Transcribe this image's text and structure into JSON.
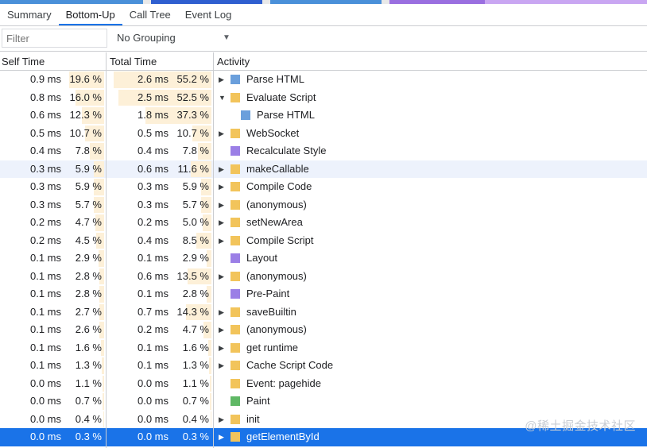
{
  "top_strip_colors": [
    "#4a90d9",
    "#e9e9e9",
    "#2f5fd0",
    "#e9e9e9",
    "#4a90d9",
    "#e9e9e9",
    "#9a6fe0",
    "#c9a6f2"
  ],
  "tabs": [
    {
      "label": "Summary",
      "active": false
    },
    {
      "label": "Bottom-Up",
      "active": true
    },
    {
      "label": "Call Tree",
      "active": false
    },
    {
      "label": "Event Log",
      "active": false
    }
  ],
  "toolbar": {
    "filter_placeholder": "Filter",
    "filter_value": "",
    "grouping_label": "No Grouping",
    "grouping_arrow": "▼"
  },
  "columns": {
    "self_time": "Self Time",
    "total_time": "Total Time",
    "activity": "Activity"
  },
  "colors": {
    "scripting": "#f2c45b",
    "loading": "#6a9fdc",
    "rendering": "#9b7fe6",
    "painting": "#5fb865",
    "bar": "#fdf0d8",
    "selected": "#1a73e8",
    "hover": "#edf2fc"
  },
  "rows": [
    {
      "self_ms": "0.9 ms",
      "self_pct": "19.6 %",
      "self_frac": 0.196,
      "total_ms": "2.6 ms",
      "total_pct": "55.2 %",
      "total_frac": 0.552,
      "expander": "right",
      "indent": 0,
      "category": "loading",
      "name": "Parse HTML",
      "state": ""
    },
    {
      "self_ms": "0.8 ms",
      "self_pct": "16.0 %",
      "self_frac": 0.16,
      "total_ms": "2.5 ms",
      "total_pct": "52.5 %",
      "total_frac": 0.525,
      "expander": "down",
      "indent": 0,
      "category": "scripting",
      "name": "Evaluate Script",
      "state": ""
    },
    {
      "self_ms": "0.6 ms",
      "self_pct": "12.3 %",
      "self_frac": 0.123,
      "total_ms": "1.8 ms",
      "total_pct": "37.3 %",
      "total_frac": 0.373,
      "expander": "none",
      "indent": 1,
      "category": "loading",
      "name": "Parse HTML",
      "state": ""
    },
    {
      "self_ms": "0.5 ms",
      "self_pct": "10.7 %",
      "self_frac": 0.107,
      "total_ms": "0.5 ms",
      "total_pct": "10.7 %",
      "total_frac": 0.107,
      "expander": "right",
      "indent": 0,
      "category": "scripting",
      "name": "WebSocket",
      "state": ""
    },
    {
      "self_ms": "0.4 ms",
      "self_pct": "7.8 %",
      "self_frac": 0.078,
      "total_ms": "0.4 ms",
      "total_pct": "7.8 %",
      "total_frac": 0.078,
      "expander": "none",
      "indent": 0,
      "category": "rendering",
      "name": "Recalculate Style",
      "state": ""
    },
    {
      "self_ms": "0.3 ms",
      "self_pct": "5.9 %",
      "self_frac": 0.059,
      "total_ms": "0.6 ms",
      "total_pct": "11.6 %",
      "total_frac": 0.116,
      "expander": "right",
      "indent": 0,
      "category": "scripting",
      "name": "makeCallable",
      "state": "hover"
    },
    {
      "self_ms": "0.3 ms",
      "self_pct": "5.9 %",
      "self_frac": 0.059,
      "total_ms": "0.3 ms",
      "total_pct": "5.9 %",
      "total_frac": 0.059,
      "expander": "right",
      "indent": 0,
      "category": "scripting",
      "name": "Compile Code",
      "state": ""
    },
    {
      "self_ms": "0.3 ms",
      "self_pct": "5.7 %",
      "self_frac": 0.057,
      "total_ms": "0.3 ms",
      "total_pct": "5.7 %",
      "total_frac": 0.057,
      "expander": "right",
      "indent": 0,
      "category": "scripting",
      "name": "(anonymous)",
      "state": ""
    },
    {
      "self_ms": "0.2 ms",
      "self_pct": "4.7 %",
      "self_frac": 0.047,
      "total_ms": "0.2 ms",
      "total_pct": "5.0 %",
      "total_frac": 0.05,
      "expander": "right",
      "indent": 0,
      "category": "scripting",
      "name": "setNewArea",
      "state": ""
    },
    {
      "self_ms": "0.2 ms",
      "self_pct": "4.5 %",
      "self_frac": 0.045,
      "total_ms": "0.4 ms",
      "total_pct": "8.5 %",
      "total_frac": 0.085,
      "expander": "right",
      "indent": 0,
      "category": "scripting",
      "name": "Compile Script",
      "state": ""
    },
    {
      "self_ms": "0.1 ms",
      "self_pct": "2.9 %",
      "self_frac": 0.029,
      "total_ms": "0.1 ms",
      "total_pct": "2.9 %",
      "total_frac": 0.029,
      "expander": "none",
      "indent": 0,
      "category": "rendering",
      "name": "Layout",
      "state": ""
    },
    {
      "self_ms": "0.1 ms",
      "self_pct": "2.8 %",
      "self_frac": 0.028,
      "total_ms": "0.6 ms",
      "total_pct": "13.5 %",
      "total_frac": 0.135,
      "expander": "right",
      "indent": 0,
      "category": "scripting",
      "name": "(anonymous)",
      "state": ""
    },
    {
      "self_ms": "0.1 ms",
      "self_pct": "2.8 %",
      "self_frac": 0.028,
      "total_ms": "0.1 ms",
      "total_pct": "2.8 %",
      "total_frac": 0.028,
      "expander": "none",
      "indent": 0,
      "category": "rendering",
      "name": "Pre-Paint",
      "state": ""
    },
    {
      "self_ms": "0.1 ms",
      "self_pct": "2.7 %",
      "self_frac": 0.027,
      "total_ms": "0.7 ms",
      "total_pct": "14.3 %",
      "total_frac": 0.143,
      "expander": "right",
      "indent": 0,
      "category": "scripting",
      "name": "saveBuiltin",
      "state": ""
    },
    {
      "self_ms": "0.1 ms",
      "self_pct": "2.6 %",
      "self_frac": 0.026,
      "total_ms": "0.2 ms",
      "total_pct": "4.7 %",
      "total_frac": 0.047,
      "expander": "right",
      "indent": 0,
      "category": "scripting",
      "name": "(anonymous)",
      "state": ""
    },
    {
      "self_ms": "0.1 ms",
      "self_pct": "1.6 %",
      "self_frac": 0.016,
      "total_ms": "0.1 ms",
      "total_pct": "1.6 %",
      "total_frac": 0.016,
      "expander": "right",
      "indent": 0,
      "category": "scripting",
      "name": "get runtime",
      "state": ""
    },
    {
      "self_ms": "0.1 ms",
      "self_pct": "1.3 %",
      "self_frac": 0.013,
      "total_ms": "0.1 ms",
      "total_pct": "1.3 %",
      "total_frac": 0.013,
      "expander": "right",
      "indent": 0,
      "category": "scripting",
      "name": "Cache Script Code",
      "state": ""
    },
    {
      "self_ms": "0.0 ms",
      "self_pct": "1.1 %",
      "self_frac": 0.011,
      "total_ms": "0.0 ms",
      "total_pct": "1.1 %",
      "total_frac": 0.011,
      "expander": "none",
      "indent": 0,
      "category": "scripting",
      "name": "Event: pagehide",
      "state": ""
    },
    {
      "self_ms": "0.0 ms",
      "self_pct": "0.7 %",
      "self_frac": 0.007,
      "total_ms": "0.0 ms",
      "total_pct": "0.7 %",
      "total_frac": 0.007,
      "expander": "none",
      "indent": 0,
      "category": "painting",
      "name": "Paint",
      "state": ""
    },
    {
      "self_ms": "0.0 ms",
      "self_pct": "0.4 %",
      "self_frac": 0.004,
      "total_ms": "0.0 ms",
      "total_pct": "0.4 %",
      "total_frac": 0.004,
      "expander": "right",
      "indent": 0,
      "category": "scripting",
      "name": "init",
      "state": ""
    },
    {
      "self_ms": "0.0 ms",
      "self_pct": "0.3 %",
      "self_frac": 0.003,
      "total_ms": "0.0 ms",
      "total_pct": "0.3 %",
      "total_frac": 0.003,
      "expander": "right",
      "indent": 0,
      "category": "scripting",
      "name": "getElementById",
      "state": "selected"
    }
  ],
  "watermark": "@稀土掘金技术社区"
}
